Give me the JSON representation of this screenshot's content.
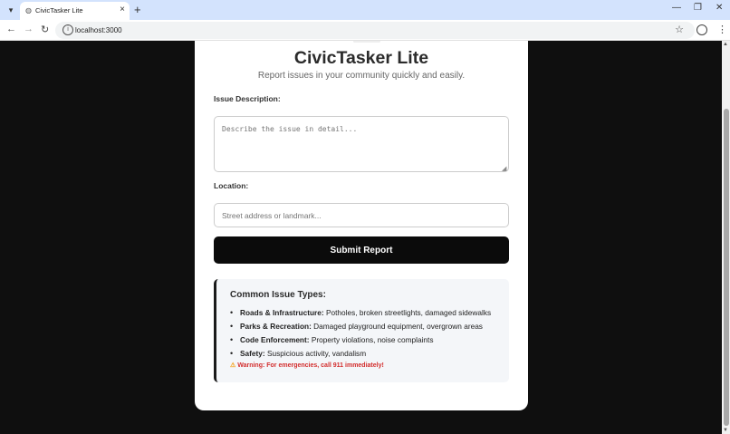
{
  "browser": {
    "tab_title": "CivicTasker Lite",
    "url": "localhost:3000",
    "icons": {
      "tab_menu": "chevron-down-icon",
      "favicon": "globe-icon",
      "close": "close-icon",
      "new_tab": "plus-icon",
      "back": "arrow-left-icon",
      "forward": "arrow-right-icon",
      "reload": "reload-icon",
      "site_info": "info-icon",
      "bookmark": "star-icon",
      "profile": "profile-icon",
      "menu": "more-vertical-icon"
    }
  },
  "app": {
    "title": "CivicTasker Lite",
    "subtitle": "Report issues in your community quickly and easily.",
    "description_label": "Issue Description:",
    "description_placeholder": "Describe the issue in detail...",
    "location_label": "Location:",
    "location_placeholder": "Street address or landmark...",
    "submit_label": "Submit Report",
    "info": {
      "title": "Common Issue Types:",
      "items": [
        {
          "name": "Roads & Infrastructure:",
          "desc": " Potholes, broken streetlights, damaged sidewalks"
        },
        {
          "name": "Parks & Recreation:",
          "desc": " Damaged playground equipment, overgrown areas"
        },
        {
          "name": "Code Enforcement:",
          "desc": " Property violations, noise complaints"
        },
        {
          "name": "Safety:",
          "desc": " Suspicious activity, vandalism"
        }
      ],
      "warning": "Warning: For emergencies, call 911 immediately!",
      "warning_icon": "warning-icon"
    }
  },
  "colors": {
    "page_bg": "#0f0f0f",
    "button_bg": "#0b0b0b",
    "warning_text": "#d32f2f",
    "info_bg": "#f4f6f9"
  }
}
